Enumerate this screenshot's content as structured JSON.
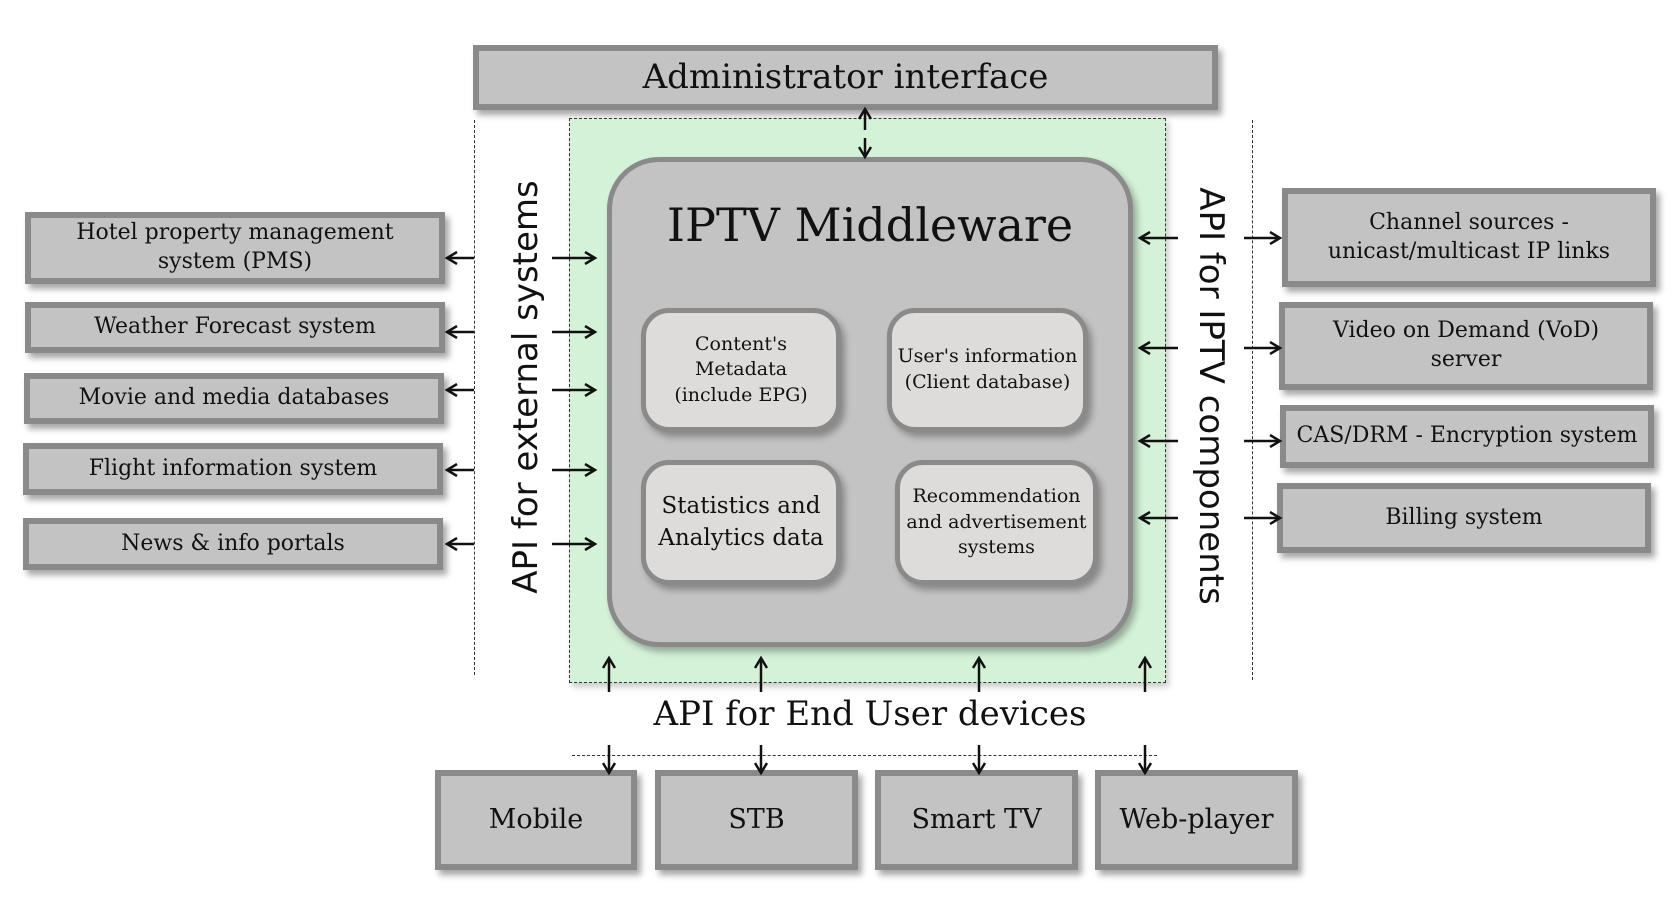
{
  "admin": {
    "label": "Administrator interface"
  },
  "middleware": {
    "title": "IPTV Middleware",
    "modules": [
      {
        "label": "Content's Metadata\n(include EPG)"
      },
      {
        "label": "User's information\n(Client database)"
      },
      {
        "label": "Statistics and\nAnalytics data"
      },
      {
        "label": "Recommendation\nand advertisement\nsystems"
      }
    ]
  },
  "api_labels": {
    "external": "API for external systems",
    "components": "API for IPTV components",
    "end_user": "API for End User devices"
  },
  "external_systems": [
    {
      "label": "Hotel property management\nsystem (PMS)"
    },
    {
      "label": "Weather Forecast system"
    },
    {
      "label": "Movie and media databases"
    },
    {
      "label": "Flight information system"
    },
    {
      "label": "News & info portals"
    }
  ],
  "iptv_components": [
    {
      "label": "Channel sources -\nunicast/multicast  IP links"
    },
    {
      "label": "Video on Demand (VoD)\nserver"
    },
    {
      "label": "CAS/DRM - Encryption system"
    },
    {
      "label": "Billing system"
    }
  ],
  "end_user_devices": [
    {
      "label": "Mobile"
    },
    {
      "label": "STB"
    },
    {
      "label": "Smart TV"
    },
    {
      "label": "Web-player"
    }
  ],
  "colors": {
    "box_fill": "#c3c3c3",
    "box_border": "#8a8a8a",
    "module_fill": "#dedbdb",
    "api_zone": "#d4f2d8"
  }
}
